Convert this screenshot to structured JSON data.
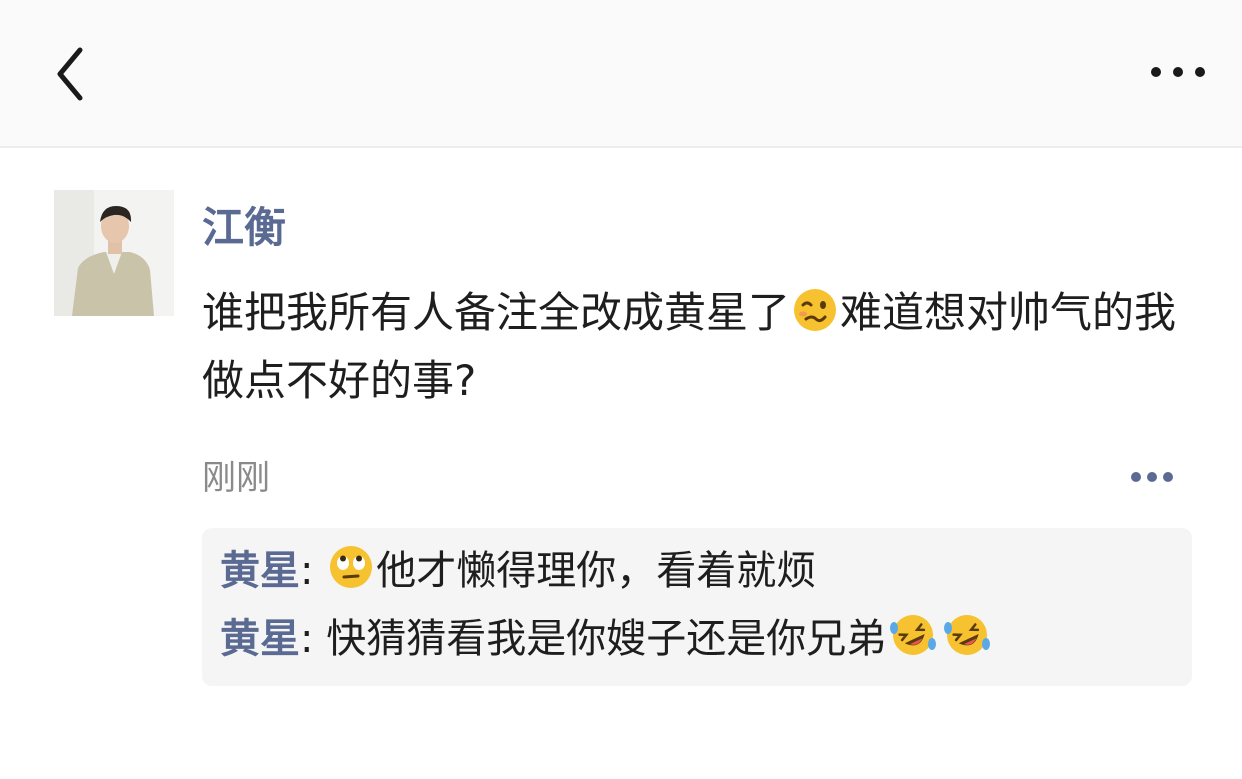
{
  "header": {
    "back_icon": "chevron-left-icon",
    "more_icon": "ellipsis-icon"
  },
  "post": {
    "author": "江衡",
    "avatar_icon": "user-avatar",
    "text_part1": "谁把我所有人备注全改成黄星了",
    "emoji1": "woozy-face-emoji",
    "text_part2": "难道想对帅气的我做点不好的事?",
    "time": "刚刚",
    "more_icon": "ellipsis-icon"
  },
  "comments": [
    {
      "name": "黄星",
      "sep": ": ",
      "emoji_before": "rolling-eyes-emoji",
      "text": "他才懒得理你，看着就烦"
    },
    {
      "name": "黄星",
      "sep": ": ",
      "text": "快猜猜看我是你嫂子还是你兄弟",
      "emoji_after": [
        "rofl-emoji",
        "rofl-emoji"
      ]
    }
  ],
  "colors": {
    "name_blue": "#5a6a92",
    "emoji_yellow": "#f7c22f",
    "comment_bg": "#f5f5f5",
    "more_dots_blue": "#5a6a92"
  }
}
